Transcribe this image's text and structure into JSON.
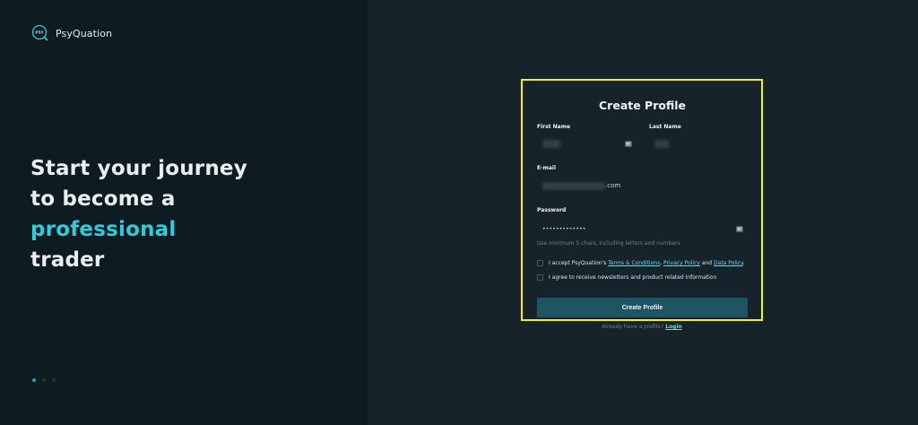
{
  "brand": {
    "name": "PsyQuation",
    "logo_text": "PSY"
  },
  "hero": {
    "line1": "Start your journey",
    "line2": "to become a",
    "accent": "professional",
    "line4": "trader"
  },
  "carousel": {
    "count": 3,
    "active": 1
  },
  "form": {
    "title": "Create Profile",
    "first_name_label": "First Name",
    "last_name_label": "Last Name",
    "email_label": "E-mail",
    "email_suffix": ".com",
    "password_label": "Password",
    "password_value": "•••••••••••••",
    "password_hint": "Use minimum 5 chars, including letters and numbers",
    "terms": {
      "prefix": "I accept PsyQuation's ",
      "terms_link": "Terms & Conditions",
      "comma": ", ",
      "privacy_link": "Privacy Policy",
      "and": " and ",
      "data_link": "Data Policy",
      "suffix": "."
    },
    "newsletter": "I agree to receive newsletters and product related information",
    "submit": "Create Profile",
    "login_prompt": "Already have a profile? ",
    "login_link": "Login"
  },
  "colors": {
    "left_bg": "#0e1b21",
    "right_bg": "#16232a",
    "accent": "#2ecdd9",
    "highlight": "#f3f01c",
    "button": "#1e5562"
  }
}
